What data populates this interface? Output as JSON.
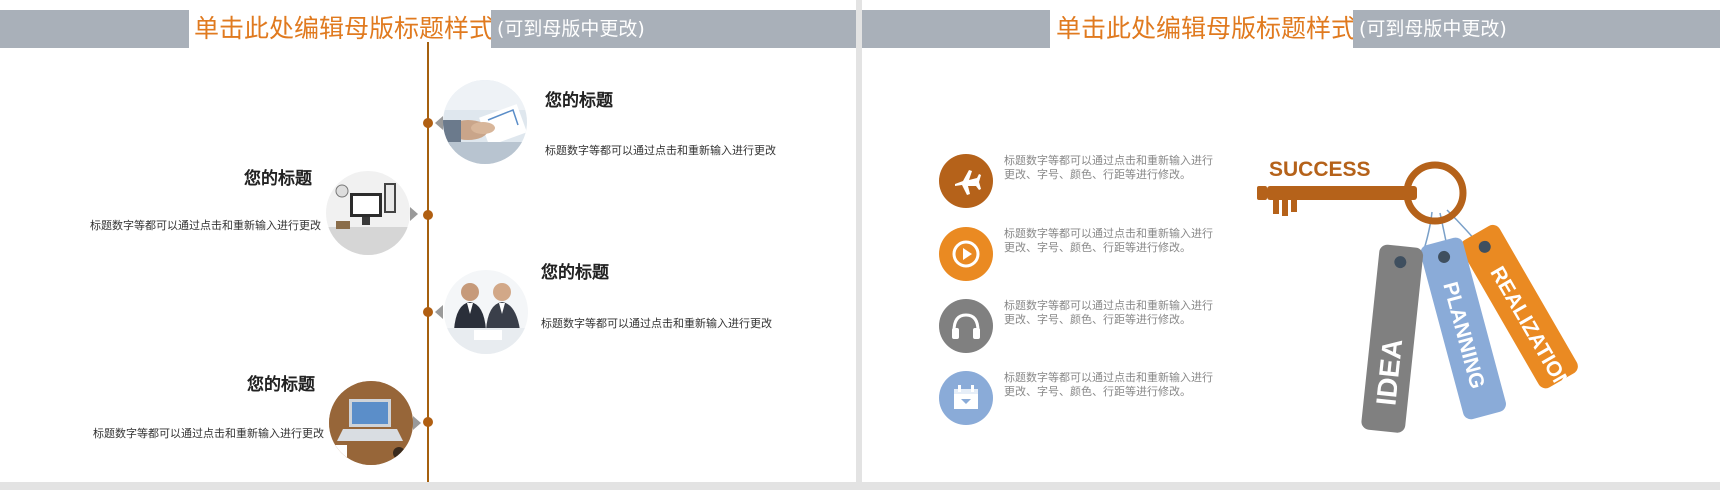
{
  "slide_left": {
    "title_main": "单击此处编辑母版标题样式",
    "title_sub": "(可到母版中更改)",
    "items": [
      {
        "title": "您的标题",
        "desc": "标题数字等都可以通过点击和重新输入进行更改"
      },
      {
        "title": "您的标题",
        "desc": "标题数字等都可以通过点击和重新输入进行更改"
      },
      {
        "title": "您的标题",
        "desc": "标题数字等都可以通过点击和重新输入进行更改"
      },
      {
        "title": "您的标题",
        "desc": "标题数字等都可以通过点击和重新输入进行更改"
      }
    ]
  },
  "slide_right": {
    "title_main": "单击此处编辑母版标题样式",
    "title_sub": "(可到母版中更改)",
    "list": [
      {
        "text": "标题数字等都可以通过点击和重新输入进行更改、字号、颜色、行距等进行修改。",
        "icon": "airplane-icon",
        "color": "#b5621a"
      },
      {
        "text": "标题数字等都可以通过点击和重新输入进行更改、字号、颜色、行距等进行修改。",
        "icon": "play-icon",
        "color": "#ea8a22"
      },
      {
        "text": "标题数字等都可以通过点击和重新输入进行更改、字号、颜色、行距等进行修改。",
        "icon": "headphones-icon",
        "color": "#808080"
      },
      {
        "text": "标题数字等都可以通过点击和重新输入进行更改、字号、颜色、行距等进行修改。",
        "icon": "calendar-icon",
        "color": "#8aabd8"
      }
    ],
    "graphic": {
      "key_label": "SUCCESS",
      "tags": [
        {
          "label": "IDEA",
          "color": "#808080"
        },
        {
          "label": "PLANNING",
          "color": "#8aabd8"
        },
        {
          "label": "REALIZATION",
          "color": "#ea8a22"
        }
      ],
      "key_color": "#b5621a"
    }
  }
}
